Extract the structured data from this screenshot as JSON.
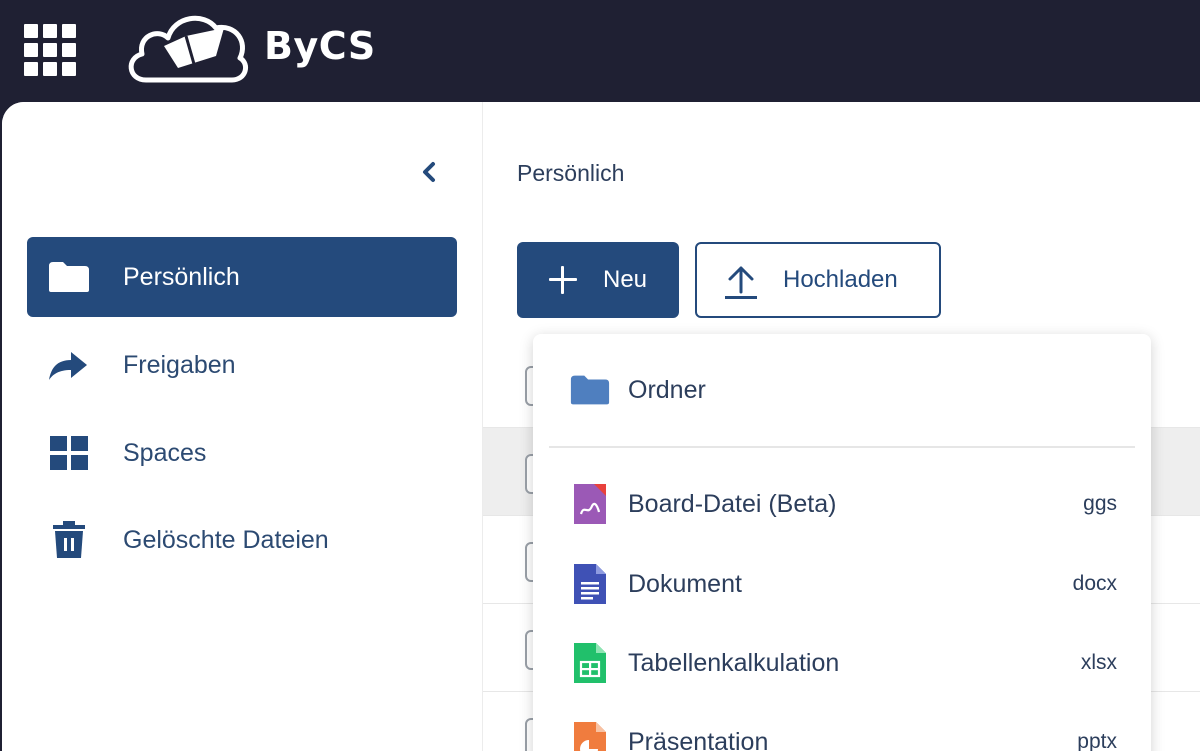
{
  "header": {
    "brand": "ByCS",
    "apps_icon": "apps-grid-icon"
  },
  "sidebar": {
    "collapse_icon": "chevron-left-icon",
    "items": [
      {
        "label": "Persönlich",
        "icon": "folder-icon",
        "active": true
      },
      {
        "label": "Freigaben",
        "icon": "share-arrow-icon",
        "active": false
      },
      {
        "label": "Spaces",
        "icon": "grid-icon",
        "active": false
      },
      {
        "label": "Gelöschte Dateien",
        "icon": "trash-icon",
        "active": false
      }
    ]
  },
  "main": {
    "breadcrumb": "Persönlich",
    "new_button": "Neu",
    "upload_button": "Hochladen"
  },
  "new_menu": {
    "folder": {
      "label": "Ordner",
      "icon": "folder-icon"
    },
    "items": [
      {
        "label": "Board-Datei (Beta)",
        "ext": "ggs",
        "icon": "board-file-icon"
      },
      {
        "label": "Dokument",
        "ext": "docx",
        "icon": "document-icon"
      },
      {
        "label": "Tabellenkalkulation",
        "ext": "xlsx",
        "icon": "spreadsheet-icon"
      },
      {
        "label": "Präsentation",
        "ext": "pptx",
        "icon": "presentation-icon"
      }
    ]
  },
  "colors": {
    "topbar": "#1f2033",
    "primary": "#244a7c",
    "folder": "#4f7fbf",
    "board": "#9b59b6",
    "document": "#3f51b5",
    "spreadsheet": "#21c06b",
    "presentation": "#f07c3e"
  }
}
